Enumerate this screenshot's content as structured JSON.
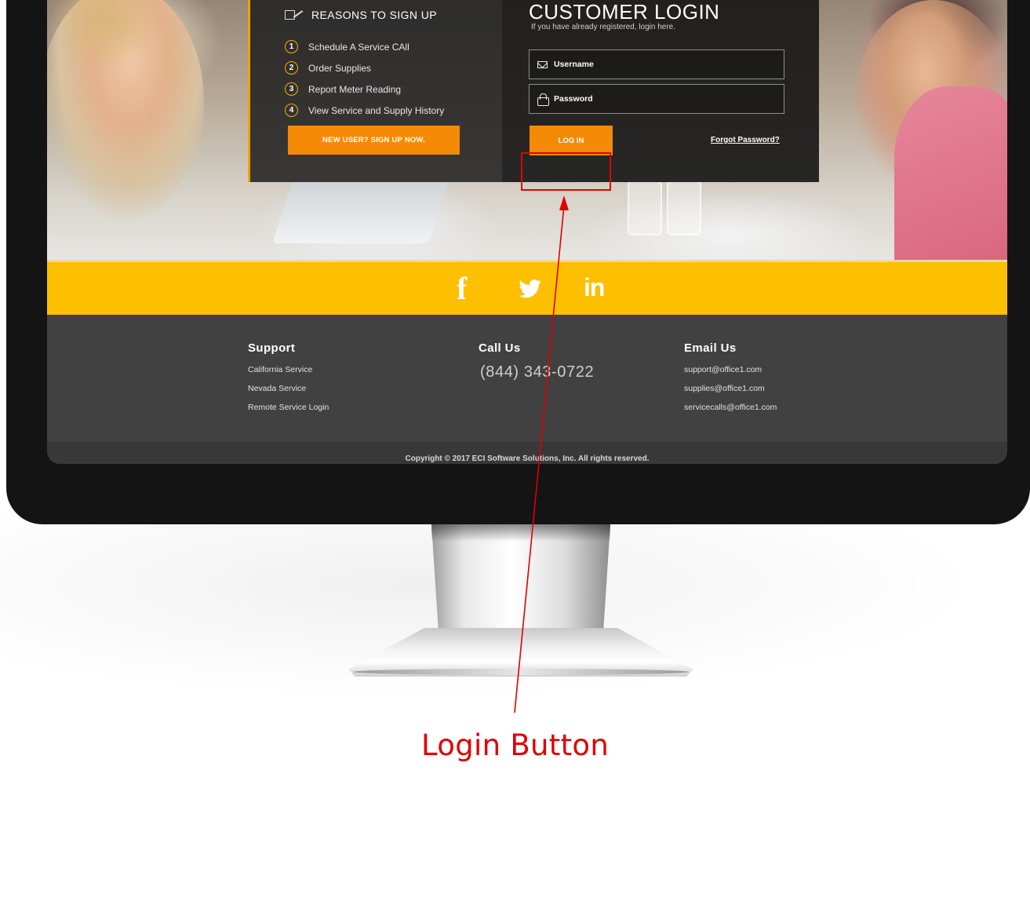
{
  "reasons": {
    "title": "REASONS TO SIGN UP",
    "items": [
      {
        "num": "1",
        "label": "Schedule A Service CAll"
      },
      {
        "num": "2",
        "label": "Order Supplies"
      },
      {
        "num": "3",
        "label": "Report Meter Reading"
      },
      {
        "num": "4",
        "label": "View Service and Supply History"
      }
    ],
    "signup_label": "NEW USER? SIGN UP NOW."
  },
  "login": {
    "title": "CUSTOMER LOGIN",
    "subtitle": "If you have already registered, login here.",
    "username_placeholder": "Username",
    "password_placeholder": "Password",
    "button_label": "LOG IN",
    "forgot_label": "Forgot Password?"
  },
  "social": {
    "facebook_glyph": "f",
    "linkedin_glyph": "in"
  },
  "footer": {
    "support": {
      "title": "Support",
      "links": [
        "California Service",
        "Nevada Service",
        "Remote Service Login"
      ]
    },
    "call": {
      "title": "Call Us",
      "phone": "(844) 343-0722"
    },
    "email": {
      "title": "Email Us",
      "links": [
        "support@office1.com",
        "supplies@office1.com",
        "servicecalls@office1.com"
      ]
    },
    "copyright": "Copyright © 2017 ECI Software Solutions, Inc. All rights reserved."
  },
  "annotation": {
    "label": "Login Button",
    "color": "#e00000"
  },
  "colors": {
    "accent_orange": "#f58a07",
    "social_yellow": "#fcc000",
    "footer_dark": "#414141"
  }
}
